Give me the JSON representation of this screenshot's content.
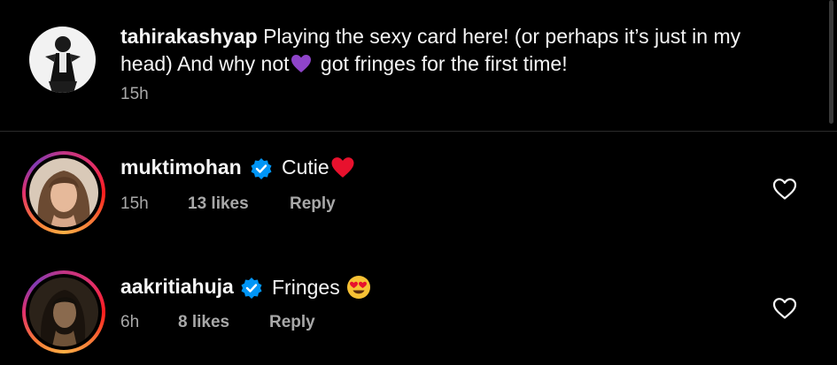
{
  "caption": {
    "username": "tahirakashyap",
    "text_part1": "Playing the sexy card here! (or perhaps it’s just in my",
    "text_part2": "head) And why not",
    "emoji": "purple-heart",
    "text_part3": "got fringes for the first time!",
    "time": "15h"
  },
  "comments": [
    {
      "username": "muktimohan",
      "verified": true,
      "text": "Cutie",
      "emoji": "red-heart",
      "time": "15h",
      "likes": "13 likes",
      "reply_label": "Reply"
    },
    {
      "username": "aakritiahuja",
      "verified": true,
      "text": "Fringes",
      "emoji": "heart-eyes-face",
      "time": "6h",
      "likes": "8 likes",
      "reply_label": "Reply"
    }
  ],
  "colors": {
    "background": "#000000",
    "text": "#f5f5f5",
    "meta": "#a8a8a8",
    "verified": "#0095f6",
    "purple_heart": "#8e44c9",
    "red_heart": "#e8112d"
  }
}
